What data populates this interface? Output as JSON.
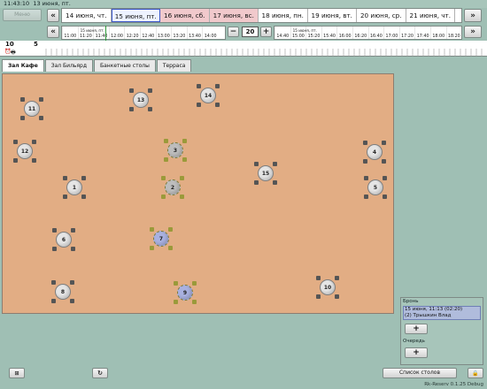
{
  "titlebar": {
    "time": "11:43:10",
    "date": "13 июня, пт."
  },
  "toolbar": {
    "menu_label": "Меню",
    "prev": "«",
    "next": "»"
  },
  "days": [
    {
      "label": "14 июня, чт.",
      "kind": "normal"
    },
    {
      "label": "15 июня, пт.",
      "kind": "today"
    },
    {
      "label": "16 июня, сб.",
      "kind": "weekend"
    },
    {
      "label": "17 июня, вс.",
      "kind": "weekend"
    },
    {
      "label": "18 июня, пн.",
      "kind": "normal"
    },
    {
      "label": "19 июня, вт.",
      "kind": "normal"
    },
    {
      "label": "20 июня, ср.",
      "kind": "normal"
    },
    {
      "label": "21 июня, чт.",
      "kind": "normal"
    },
    {
      "label": "2",
      "kind": "normal"
    }
  ],
  "timeline": {
    "left_date": "15 июня, пт.",
    "left_times": [
      "11:00",
      "11:20",
      "11:40",
      "12:00",
      "12:20",
      "12:40",
      "13:00",
      "13:20",
      "13:40",
      "14:00"
    ],
    "zoom_minus": "−",
    "zoom_value": "20",
    "zoom_plus": "+",
    "right_date": "15 июня, пт.",
    "right_times": [
      "14:40",
      "15:00",
      "15:20",
      "15:40",
      "16:00",
      "16:20",
      "16:40",
      "17:00",
      "17:20",
      "17:40",
      "18:00",
      "18:20",
      "18:40",
      "19:00"
    ]
  },
  "ruler": {
    "a": "10",
    "b": "5"
  },
  "tabs": [
    "Зал Кафе",
    "Зал Бильярд",
    "Банкетные столы",
    "Терраса"
  ],
  "tables": [
    {
      "n": "11",
      "status": "free"
    },
    {
      "n": "13",
      "status": "free"
    },
    {
      "n": "14",
      "status": "free"
    },
    {
      "n": "12",
      "status": "free"
    },
    {
      "n": "3",
      "status": "busy"
    },
    {
      "n": "4",
      "status": "free"
    },
    {
      "n": "15",
      "status": "free"
    },
    {
      "n": "1",
      "status": "free"
    },
    {
      "n": "2",
      "status": "busy"
    },
    {
      "n": "5",
      "status": "free"
    },
    {
      "n": "6",
      "status": "free"
    },
    {
      "n": "7",
      "status": "reserved"
    },
    {
      "n": "8",
      "status": "free"
    },
    {
      "n": "9",
      "status": "reserved"
    },
    {
      "n": "10",
      "status": "free"
    }
  ],
  "side": {
    "bron_label": "Бронь",
    "bron_line1": "15 июня, 11:13  (02:20)",
    "bron_line2": "(2) Трышкин Влад",
    "add": "+",
    "queue_label": "Очередь"
  },
  "bottom": {
    "tables_list": "Список столов",
    "version": "Rk-Reserv 0.1.25 Debug"
  },
  "colors": {
    "background": "#9fbfb4",
    "floor": "#e2ad84",
    "weekend": "#f1c9cc",
    "reserved": "#a9b1e0"
  }
}
